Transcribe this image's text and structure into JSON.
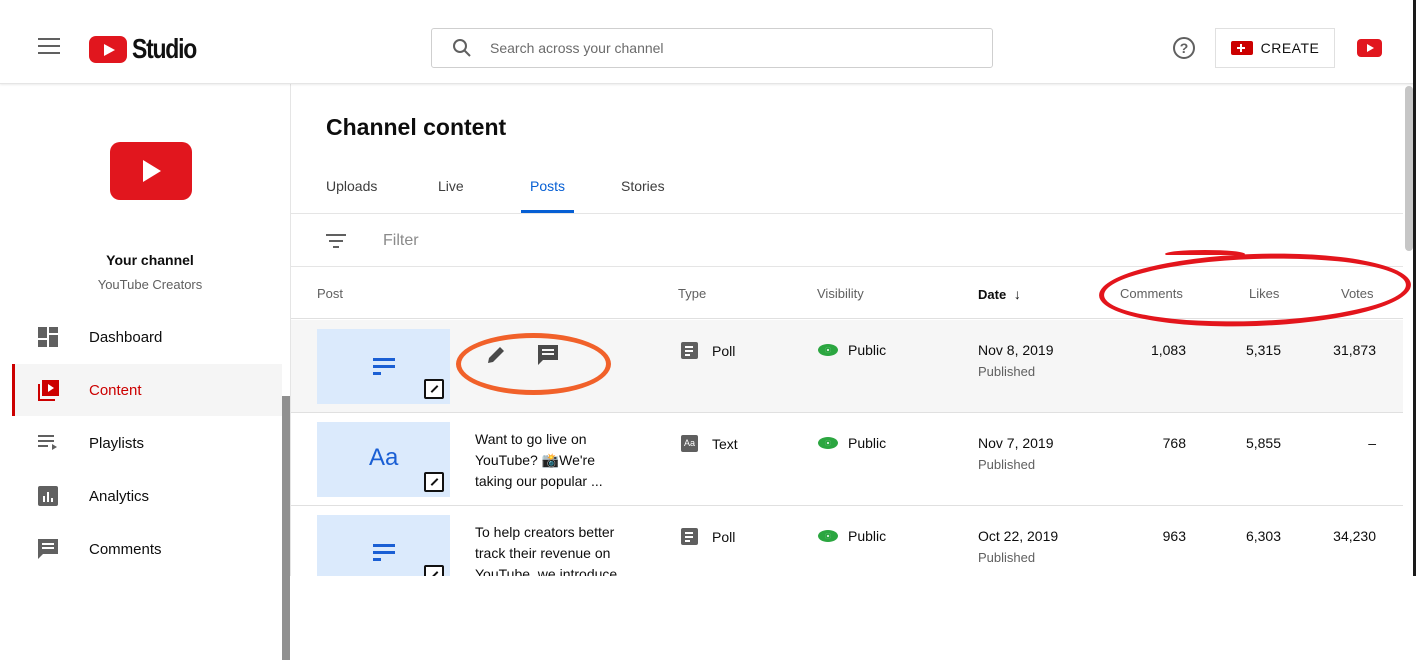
{
  "header": {
    "logo_text": "Studio",
    "search_placeholder": "Search across your channel",
    "help_glyph": "?",
    "create_label": "CREATE"
  },
  "sidebar": {
    "channel_name": "Your channel",
    "channel_sub": "YouTube Creators",
    "items": [
      {
        "label": "Dashboard",
        "icon": "dashboard-icon"
      },
      {
        "label": "Content",
        "icon": "content-icon"
      },
      {
        "label": "Playlists",
        "icon": "playlists-icon"
      },
      {
        "label": "Analytics",
        "icon": "analytics-icon"
      },
      {
        "label": "Comments",
        "icon": "comments-icon"
      }
    ]
  },
  "main": {
    "title": "Channel content",
    "tabs": [
      "Uploads",
      "Live",
      "Posts",
      "Stories"
    ],
    "active_tab": "Posts",
    "filter_label": "Filter",
    "columns": {
      "post": "Post",
      "type": "Type",
      "visibility": "Visibility",
      "date": "Date",
      "date_sort_glyph": "↓",
      "comments": "Comments",
      "likes": "Likes",
      "votes": "Votes"
    },
    "rows": [
      {
        "thumb": "poll",
        "desc": "",
        "type": "Poll",
        "visibility": "Public",
        "date": "Nov 8, 2019",
        "status": "Published",
        "comments": "1,083",
        "likes": "5,315",
        "votes": "31,873"
      },
      {
        "thumb": "text",
        "thumb_label": "Aa",
        "desc": "Want to go live on YouTube? 📸We're taking our popular ...",
        "type": "Text",
        "type_icon_label": "Aa",
        "visibility": "Public",
        "date": "Nov 7, 2019",
        "status": "Published",
        "comments": "768",
        "likes": "5,855",
        "votes": "–"
      },
      {
        "thumb": "poll",
        "desc": "To help creators better track their revenue on YouTube, we introduce...",
        "type": "Poll",
        "visibility": "Public",
        "date": "Oct 22, 2019",
        "status": "Published",
        "comments": "963",
        "likes": "6,303",
        "votes": "34,230"
      }
    ]
  },
  "colors": {
    "brand_red": "#e1161e",
    "accent_blue": "#065fd4",
    "public_green": "#2ba640",
    "annotation_red": "#e3151c",
    "annotation_orange": "#f1612a"
  }
}
